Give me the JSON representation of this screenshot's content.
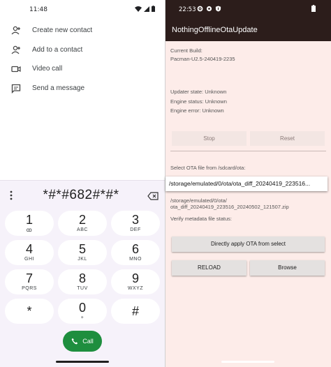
{
  "dialer": {
    "status_time": "11:48",
    "actions": [
      {
        "label": "Create new contact",
        "icon": "person-add-icon"
      },
      {
        "label": "Add to a contact",
        "icon": "person-add-icon"
      },
      {
        "label": "Video call",
        "icon": "video-camera-icon"
      },
      {
        "label": "Send a message",
        "icon": "message-icon"
      }
    ],
    "entered_digits": "*#*#682#*#*",
    "keys": [
      {
        "num": "1",
        "sub": "ꝏ"
      },
      {
        "num": "2",
        "sub": "ABC"
      },
      {
        "num": "3",
        "sub": "DEF"
      },
      {
        "num": "4",
        "sub": "GHI"
      },
      {
        "num": "5",
        "sub": "JKL"
      },
      {
        "num": "6",
        "sub": "MNO"
      },
      {
        "num": "7",
        "sub": "PQRS"
      },
      {
        "num": "8",
        "sub": "TUV"
      },
      {
        "num": "9",
        "sub": "WXYZ"
      },
      {
        "num": "*",
        "sub": ""
      },
      {
        "num": "0",
        "sub": "+"
      },
      {
        "num": "#",
        "sub": ""
      }
    ],
    "call_label": "Call",
    "colors": {
      "call": "#1e8e3e",
      "pad_bg": "#f6f2fa"
    }
  },
  "ota": {
    "status_time": "22:53",
    "title": "NothingOfflineOtaUpdate",
    "current_build_label": "Current Build:",
    "current_build": "Pacman-U2.5-240419-2235",
    "updater_state": "Updater state:  Unknown",
    "engine_status": "Engine status:  Unknown",
    "engine_error": "Engine error:  Unknown",
    "stop_label": "Stop",
    "reset_label": "Reset",
    "select_ota_label": "Select OTA file from /sdcard/ota:",
    "selected_path_line1": "/storage/emulated/0/ota/",
    "selected_path_line2": "ota_diff_20240419_223516_20240502_121507.zip",
    "verify_label": "Verify metadata file status:",
    "apply_label": "Directly apply OTA from select",
    "reload_label": "RELOAD",
    "browse_label": "Browse",
    "dropdown_value": "/storage/emulated/0/ota/ota_diff_20240419_223516...",
    "colors": {
      "appbar": "#2c1d1b",
      "background": "#fdece9"
    }
  }
}
